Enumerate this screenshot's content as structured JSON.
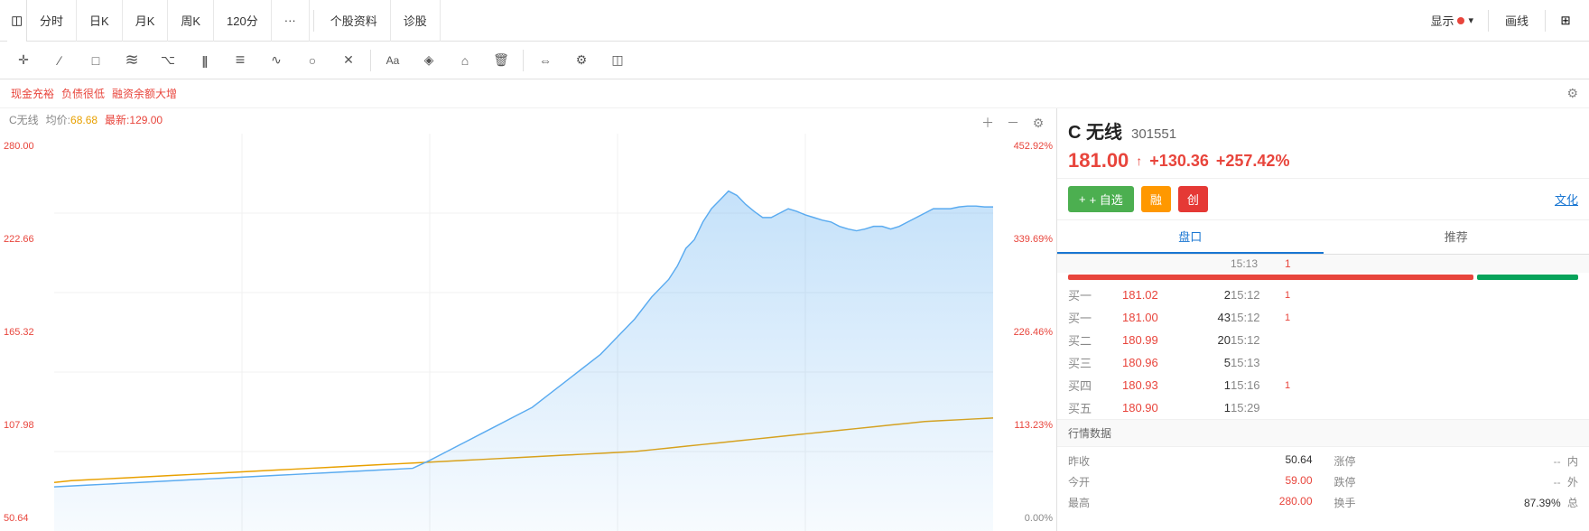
{
  "topbar": {
    "sidebar_icon": "☰",
    "tabs": [
      {
        "label": "分时",
        "active": false
      },
      {
        "label": "日K",
        "active": false
      },
      {
        "label": "月K",
        "active": false
      },
      {
        "label": "周K",
        "active": false
      },
      {
        "label": "120分",
        "active": false
      },
      {
        "label": "···",
        "active": false
      },
      {
        "label": "个股资料",
        "active": false
      },
      {
        "label": "诊股",
        "active": false
      }
    ],
    "display_label": "显示",
    "draw_label": "画线",
    "layout_icon": "⊞"
  },
  "drawing_tools": [
    {
      "name": "cursor",
      "icon": "✛"
    },
    {
      "name": "pen",
      "icon": "∕"
    },
    {
      "name": "rect",
      "icon": "□"
    },
    {
      "name": "parallel",
      "icon": "≡"
    },
    {
      "name": "fibonacci",
      "icon": "⌥"
    },
    {
      "name": "vertical",
      "icon": "|||"
    },
    {
      "name": "horizontal",
      "icon": "≡"
    },
    {
      "name": "wave",
      "icon": "∿"
    },
    {
      "name": "circle",
      "icon": "○"
    },
    {
      "name": "cross",
      "icon": "✕"
    },
    {
      "name": "text",
      "icon": "Aa"
    },
    {
      "name": "color",
      "icon": "◈"
    },
    {
      "name": "anchor",
      "icon": "⌂"
    },
    {
      "name": "delete",
      "icon": "🗑"
    },
    {
      "name": "move",
      "icon": "⇔"
    },
    {
      "name": "settings",
      "icon": "⚙"
    },
    {
      "name": "layers",
      "icon": "◫"
    }
  ],
  "tags": [
    {
      "label": "现金充裕"
    },
    {
      "label": "负债很低"
    },
    {
      "label": "融资余额大增"
    }
  ],
  "chart": {
    "stock_name": "C无线",
    "avg_label": "均价:",
    "avg_value": "68.68",
    "latest_label": "最新:",
    "latest_value": "129.00",
    "y_labels_left": [
      "280.00",
      "222.66",
      "165.32",
      "107.98",
      "50.64"
    ],
    "y_labels_right": [
      "452.92%",
      "339.69%",
      "226.46%",
      "113.23%",
      "0.00%"
    ]
  },
  "right_panel": {
    "stock_name": "C 无线",
    "stock_code": "301551",
    "price": "181.00",
    "arrow": "↑",
    "change": "+130.36",
    "change_pct": "+257.42%",
    "actions": {
      "add_watchlist": "+ 自选",
      "rong": "融",
      "chuang": "创",
      "wenhua": "文化"
    },
    "tabs": [
      {
        "label": "盘口",
        "active": true
      },
      {
        "label": "推荐",
        "active": false
      }
    ],
    "order_book": {
      "header_time": "15:13",
      "header_change": "1",
      "rows": [
        {
          "label": "买一",
          "price": "181.02",
          "vol": "2",
          "time": "15:12",
          "change": "1",
          "price_type": "red"
        },
        {
          "label": "买一",
          "price": "181.00",
          "vol": "43",
          "time": "15:12",
          "change": "1",
          "price_type": "red"
        },
        {
          "label": "买二",
          "price": "180.99",
          "vol": "20",
          "time": "15:12",
          "change": "",
          "price_type": "red"
        },
        {
          "label": "买三",
          "price": "180.96",
          "vol": "5",
          "time": "15:13",
          "change": "",
          "price_type": "red"
        },
        {
          "label": "买四",
          "price": "180.93",
          "vol": "1",
          "time": "15:16",
          "change": "1",
          "price_type": "red"
        },
        {
          "label": "买五",
          "price": "180.90",
          "vol": "1",
          "time": "15:29",
          "change": "",
          "price_type": "red"
        }
      ]
    },
    "market_data": {
      "header": "行情数据",
      "items": [
        {
          "label": "昨收",
          "value": "50.64",
          "value_type": "normal"
        },
        {
          "label": "涨停",
          "value": "--",
          "value_type": "gray",
          "sublabel": "内"
        },
        {
          "label": "今开",
          "value": "59.00",
          "value_type": "red"
        },
        {
          "label": "跌停",
          "value": "--",
          "value_type": "gray",
          "sublabel": "外"
        },
        {
          "label": "最高",
          "value": "280.00",
          "value_type": "red"
        },
        {
          "label": "换手",
          "value": "87.39%",
          "value_type": "normal",
          "sublabel": "总"
        }
      ]
    }
  }
}
